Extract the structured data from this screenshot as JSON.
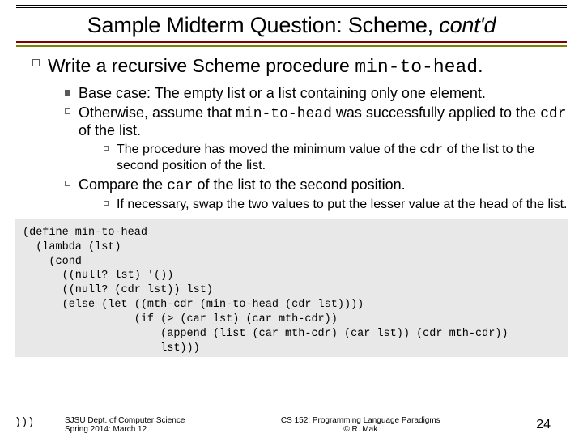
{
  "title_pre": "Sample Midterm Question: Scheme, ",
  "title_em": "cont'd",
  "intro_pre": "Write a recursive Scheme procedure ",
  "intro_code": "min-to-head",
  "intro_post": ".",
  "b1": "Base case: The empty list or a list containing only one element.",
  "b2_pre": "Otherwise, assume that ",
  "b2_code1": "min-to-head",
  "b2_mid": " was successfully applied to the ",
  "b2_code2": "cdr",
  "b2_post": " of the list.",
  "b2a_pre": "The procedure has moved the minimum value of the ",
  "b2a_code": "cdr",
  "b2a_post": " of the list to the second position of the list.",
  "b3_pre": "Compare the ",
  "b3_code": "car",
  "b3_post": " of the list to the second position.",
  "b3a": "If necessary, swap the two values to put the lesser value at the head of the list.",
  "code": "(define min-to-head\n  (lambda (lst)\n    (cond\n      ((null? lst) '())\n      ((null? (cdr lst)) lst)\n      (else (let ((mth-cdr (min-to-head (cdr lst))))\n                 (if (> (car lst) (car mth-cdr))\n                     (append (list (car mth-cdr) (car lst)) (cdr mth-cdr))\n                     lst)))",
  "dangle": ")))",
  "footer_left1": "SJSU Dept. of Computer Science",
  "footer_left2": "Spring 2014: March 12",
  "footer_mid1": "CS 152: Programming Language Paradigms",
  "footer_mid2": "© R. Mak",
  "page_no": "24"
}
